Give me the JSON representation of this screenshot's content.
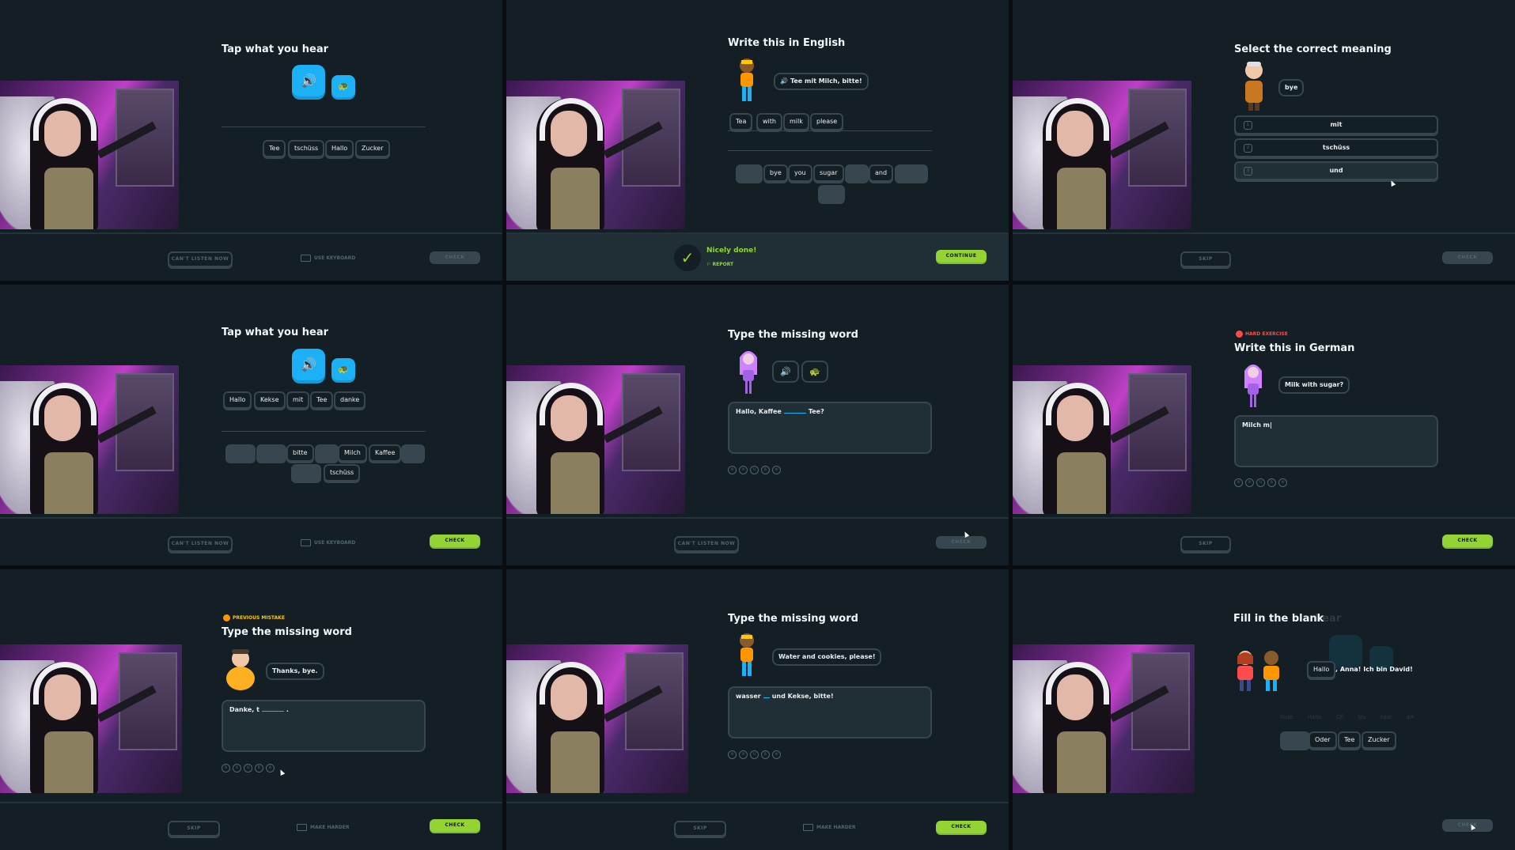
{
  "p1": {
    "title": "Tap what you hear",
    "words": [
      "Tee",
      "tschüss",
      "Hallo",
      "Zucker"
    ],
    "cant_listen": "CAN'T LISTEN NOW",
    "use_keyboard": "USE KEYBOARD",
    "check": "CHECK"
  },
  "p2": {
    "title": "Write this in English",
    "bubble": "Tee mit Milch, bitte!",
    "answer": [
      "Tea",
      "with",
      "milk",
      "please"
    ],
    "bank": [
      "bye",
      "you",
      "sugar",
      "and"
    ],
    "nicely": "Nicely done!",
    "report": "REPORT",
    "continue": "CONTINUE"
  },
  "p3": {
    "title": "Select the correct meaning",
    "bubble": "bye",
    "options": [
      {
        "num": "1",
        "label": "mit"
      },
      {
        "num": "2",
        "label": "tschüss"
      },
      {
        "num": "3",
        "label": "und"
      }
    ],
    "skip": "SKIP",
    "check": "CHECK"
  },
  "p4": {
    "title": "Tap what you hear",
    "answer": [
      "Hallo",
      "Kekse",
      "mit",
      "Tee",
      "danke"
    ],
    "bank": [
      "bitte",
      "Milch",
      "Kaffee",
      "tschüss"
    ],
    "cant_listen": "CAN'T LISTEN NOW",
    "use_keyboard": "USE KEYBOARD",
    "check": "CHECK"
  },
  "p5": {
    "title": "Type the missing word",
    "text_before": "Hallo, Kaffee",
    "text_after": "Tee?",
    "cant_listen": "CAN'T LISTEN NOW",
    "check": "CHECK"
  },
  "p6": {
    "tag": "HARD EXERCISE",
    "title": "Write this in German",
    "bubble": "Milk with sugar?",
    "typed": "Milch m|",
    "skip": "SKIP",
    "check": "CHECK"
  },
  "p7": {
    "tag": "PREVIOUS MISTAKE",
    "title": "Type the missing word",
    "bubble": "Thanks, bye.",
    "text_before": "Danke, t",
    "text_after": ".",
    "skip": "SKIP",
    "make_harder": "MAKE HARDER",
    "check": "CHECK"
  },
  "p8": {
    "title": "Type the missing word",
    "bubble": "Water and cookies, please!",
    "text_before": "wasser",
    "text_after": "und Kekse, bitte!",
    "skip": "SKIP",
    "make_harder": "MAKE HARDER",
    "check": "CHECK"
  },
  "p9": {
    "title": "Fill in the blank",
    "ghost_title": "hear",
    "answer_word": "Hallo",
    "sentence": ", Anna! Ich bin David!",
    "bank": [
      "Oder",
      "Tee",
      "Zucker"
    ],
    "ghost_words": [
      "Kuse",
      "Hallo",
      "Cfl",
      "lzu",
      "kaal",
      "alk"
    ],
    "check": "CHECK"
  },
  "colors": {
    "accent_green": "#93d333",
    "accent_blue": "#1cb0f6",
    "bg": "#131f24",
    "border": "#37464f",
    "mistake_orange": "#ffc800",
    "hard_red": "#ff4b4b"
  }
}
